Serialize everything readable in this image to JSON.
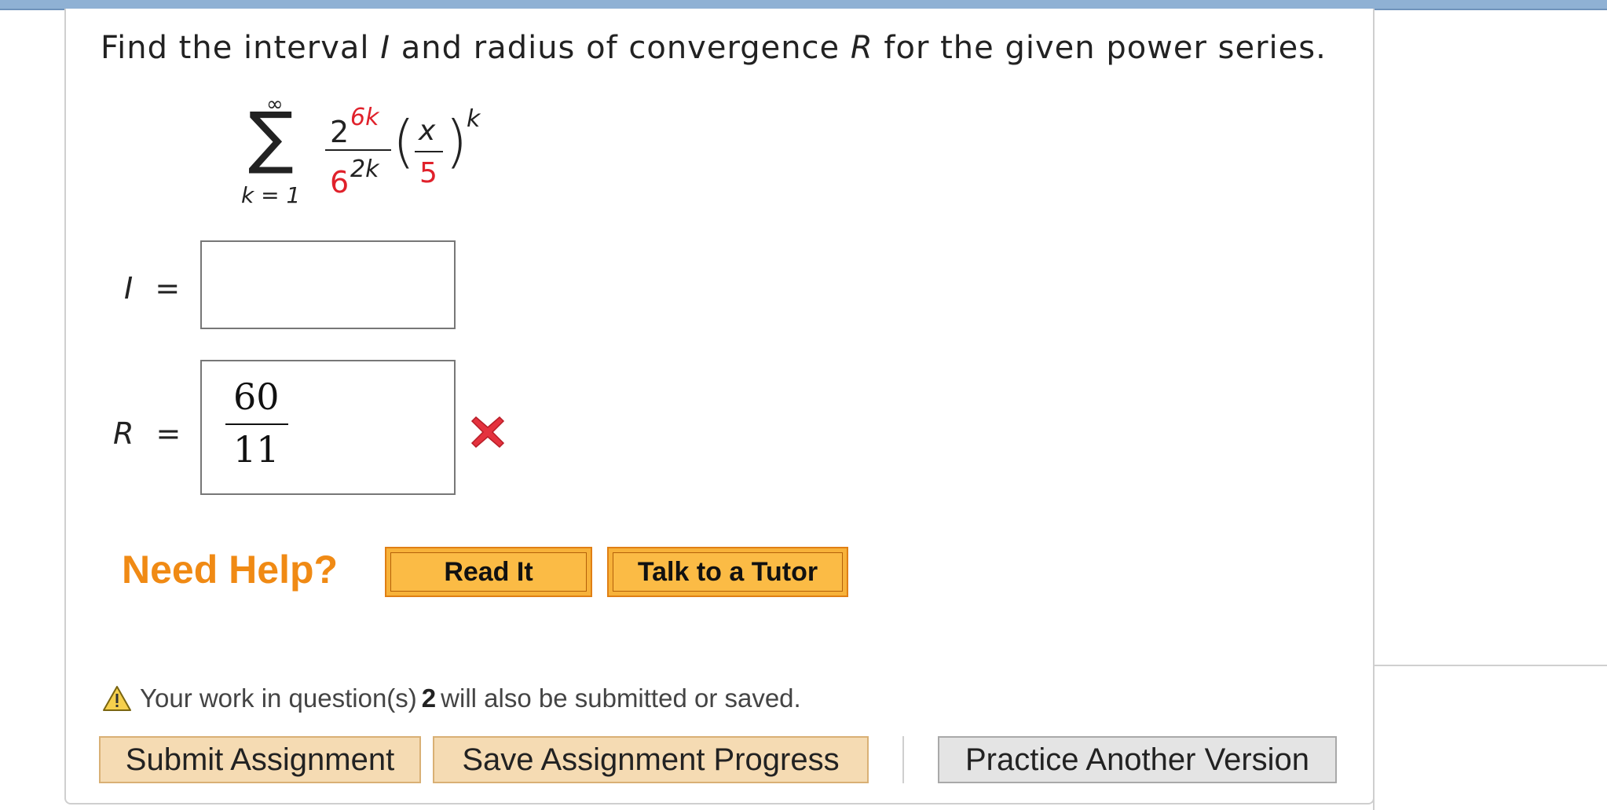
{
  "question": {
    "prefix": "Find the interval ",
    "var_I": "I",
    "middle": " and radius of convergence ",
    "var_R": "R",
    "suffix": " for the given power series."
  },
  "series": {
    "upper_limit": "∞",
    "sigma": "∑",
    "lower_limit": "k = 1",
    "num_base": "2",
    "num_exp": "6k",
    "den_base": "6",
    "den_exp": "2k",
    "inner_num": "x",
    "inner_den": "5",
    "outer_exp": "k",
    "left_paren": "(",
    "right_paren": ")"
  },
  "fields": {
    "interval_label": "I",
    "radius_label": "R",
    "equals": "=",
    "interval_value": "",
    "radius_numerator": "60",
    "radius_denominator": "11",
    "radius_status": "incorrect"
  },
  "help": {
    "title": "Need Help?",
    "read_it": "Read It",
    "talk_tutor": "Talk to a Tutor"
  },
  "warning": {
    "prefix": "Your work in question(s)",
    "number": "2",
    "suffix": "will also be submitted or saved."
  },
  "actions": {
    "submit": "Submit Assignment",
    "save": "Save Assignment Progress",
    "practice": "Practice Another Version"
  },
  "colors": {
    "accent_red": "#e0212b",
    "help_orange": "#f08a14",
    "button_orange": "#f7b23a",
    "assign_button": "#f5dbb3",
    "practice_button": "#e4e4e4",
    "topbar": "#8fb1d4"
  },
  "icons": {
    "incorrect": "x-mark-icon",
    "warning": "warning-triangle-icon"
  }
}
